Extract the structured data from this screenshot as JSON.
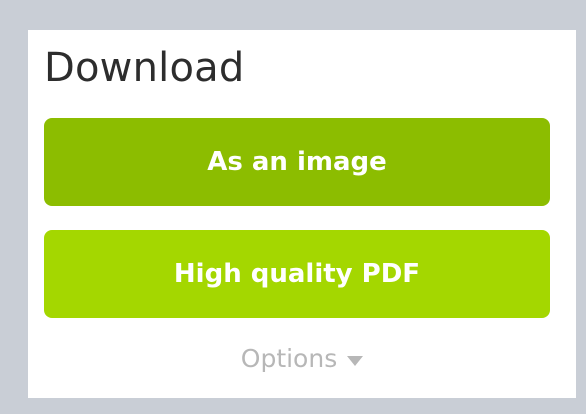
{
  "panel": {
    "title": "Download"
  },
  "buttons": {
    "image_label": "As an image",
    "pdf_label": "High quality PDF"
  },
  "options": {
    "label": "Options",
    "icon": "caret-down-icon"
  },
  "colors": {
    "background": "#c9ced6",
    "panel": "#ffffff",
    "button_primary": "#8cbd00",
    "button_secondary": "#a4d700",
    "options_text": "#b7b7b7",
    "title_text": "#2d2d2d"
  }
}
